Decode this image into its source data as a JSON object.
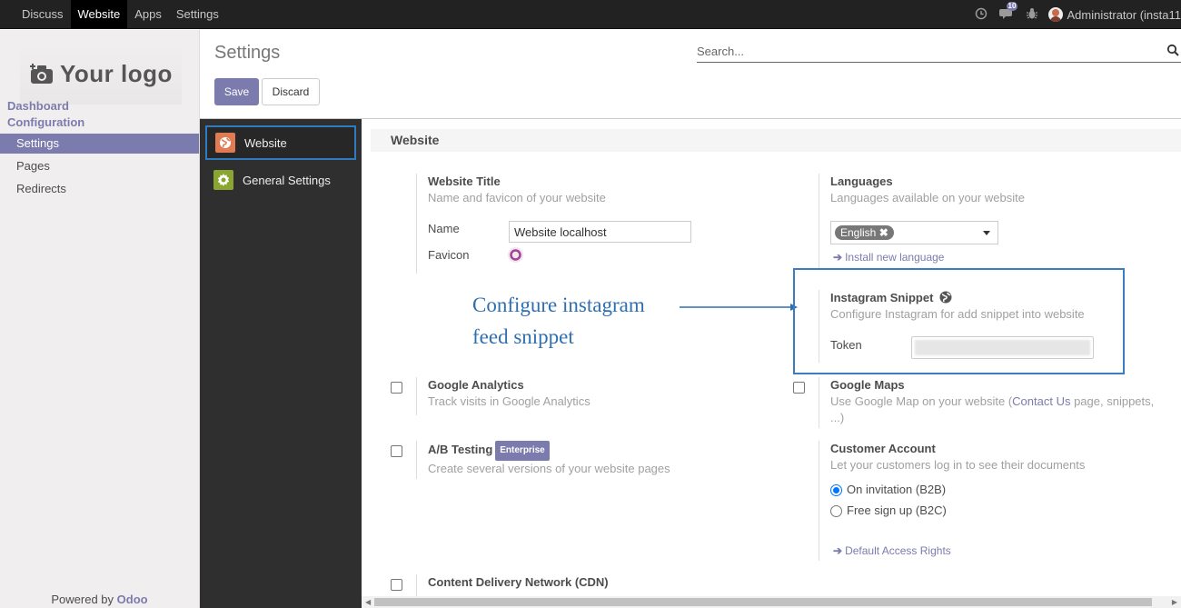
{
  "topbar": {
    "menu": [
      "Discuss",
      "Website",
      "Apps",
      "Settings"
    ],
    "active": "Website",
    "chat_count": "10",
    "user": "Administrator (insta11"
  },
  "sidebar": {
    "logo_text": "Your logo",
    "dashboard": "Dashboard",
    "configuration": "Configuration",
    "items": [
      "Settings",
      "Pages",
      "Redirects"
    ],
    "powered_prefix": "Powered by ",
    "powered_brand": "Odoo"
  },
  "control_panel": {
    "title": "Settings",
    "search_placeholder": "Search...",
    "save_label": "Save",
    "discard_label": "Discard"
  },
  "settings_tabs": [
    {
      "label": "Website",
      "active": true,
      "color": "#e07b53"
    },
    {
      "label": "General Settings",
      "active": false,
      "color": "#8aa630"
    }
  ],
  "section_title": "Website",
  "website_title": {
    "title": "Website Title",
    "desc": "Name and favicon of your website",
    "name_label": "Name",
    "name_value": "Website localhost",
    "favicon_label": "Favicon"
  },
  "languages": {
    "title": "Languages",
    "desc": "Languages available on your website",
    "tag": "English",
    "install_link": "Install new language"
  },
  "annotation": {
    "line1": "Configure instagram",
    "line2": "feed snippet"
  },
  "instagram": {
    "title": "Instagram Snippet",
    "desc": "Configure Instagram for add snippet into website",
    "token_label": "Token"
  },
  "google_analytics": {
    "title": "Google Analytics",
    "desc": "Track visits in Google Analytics",
    "checked": false
  },
  "google_maps": {
    "title": "Google Maps",
    "desc_prefix": "Use Google Map on your website (",
    "desc_link": "Contact Us",
    "desc_suffix": " page, snippets,",
    "desc_line2": "...)",
    "checked": false
  },
  "ab_testing": {
    "title": "A/B Testing",
    "badge": "Enterprise",
    "desc": "Create several versions of your website pages",
    "checked": false
  },
  "customer_account": {
    "title": "Customer Account",
    "desc": "Let your customers log in to see their documents",
    "options": [
      "On invitation (B2B)",
      "Free sign up (B2C)"
    ],
    "selected": "On invitation (B2B)",
    "access_link": "Default Access Rights"
  },
  "cdn": {
    "title": "Content Delivery Network (CDN)",
    "checked": false
  },
  "colors": {
    "brand": "#7c7bad",
    "annotation": "#2e6fb0",
    "topbar": "#222222",
    "tabs_bg": "#2f2f2f"
  }
}
